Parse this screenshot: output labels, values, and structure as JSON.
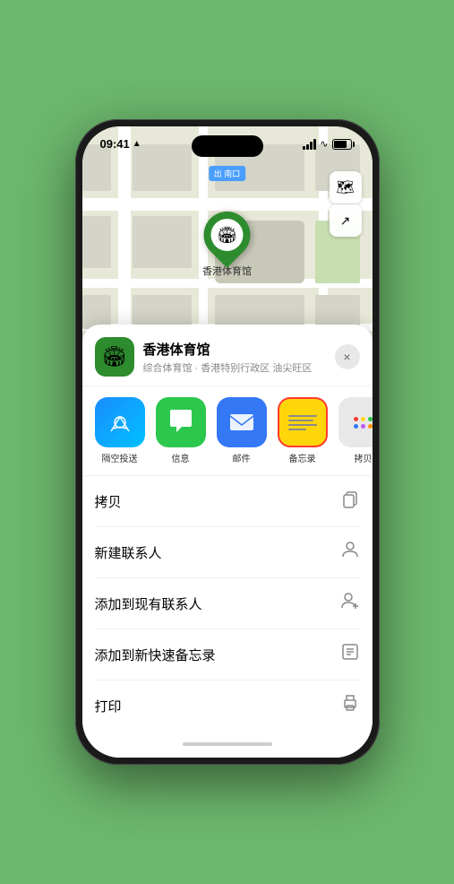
{
  "status_bar": {
    "time": "09:41",
    "location_arrow": "▶"
  },
  "map": {
    "label_text": "南口",
    "label_prefix": "出",
    "pin_label": "香港体育馆",
    "controls": {
      "map_icon": "🗺",
      "location_icon": "⬆"
    }
  },
  "bottom_sheet": {
    "venue": {
      "name": "香港体育馆",
      "subtitle": "综合体育馆 · 香港特别行政区 油尖旺区"
    },
    "close_label": "×",
    "share_items": [
      {
        "id": "airdrop",
        "label": "隔空投送"
      },
      {
        "id": "messages",
        "label": "信息"
      },
      {
        "id": "mail",
        "label": "邮件"
      },
      {
        "id": "notes",
        "label": "备忘录"
      },
      {
        "id": "more",
        "label": "拷贝"
      }
    ],
    "menu_items": [
      {
        "id": "copy",
        "label": "拷贝",
        "icon": "copy"
      },
      {
        "id": "new-contact",
        "label": "新建联系人",
        "icon": "person"
      },
      {
        "id": "add-existing",
        "label": "添加到现有联系人",
        "icon": "person-plus"
      },
      {
        "id": "add-note",
        "label": "添加到新快速备忘录",
        "icon": "memo"
      },
      {
        "id": "print",
        "label": "打印",
        "icon": "print"
      }
    ]
  }
}
